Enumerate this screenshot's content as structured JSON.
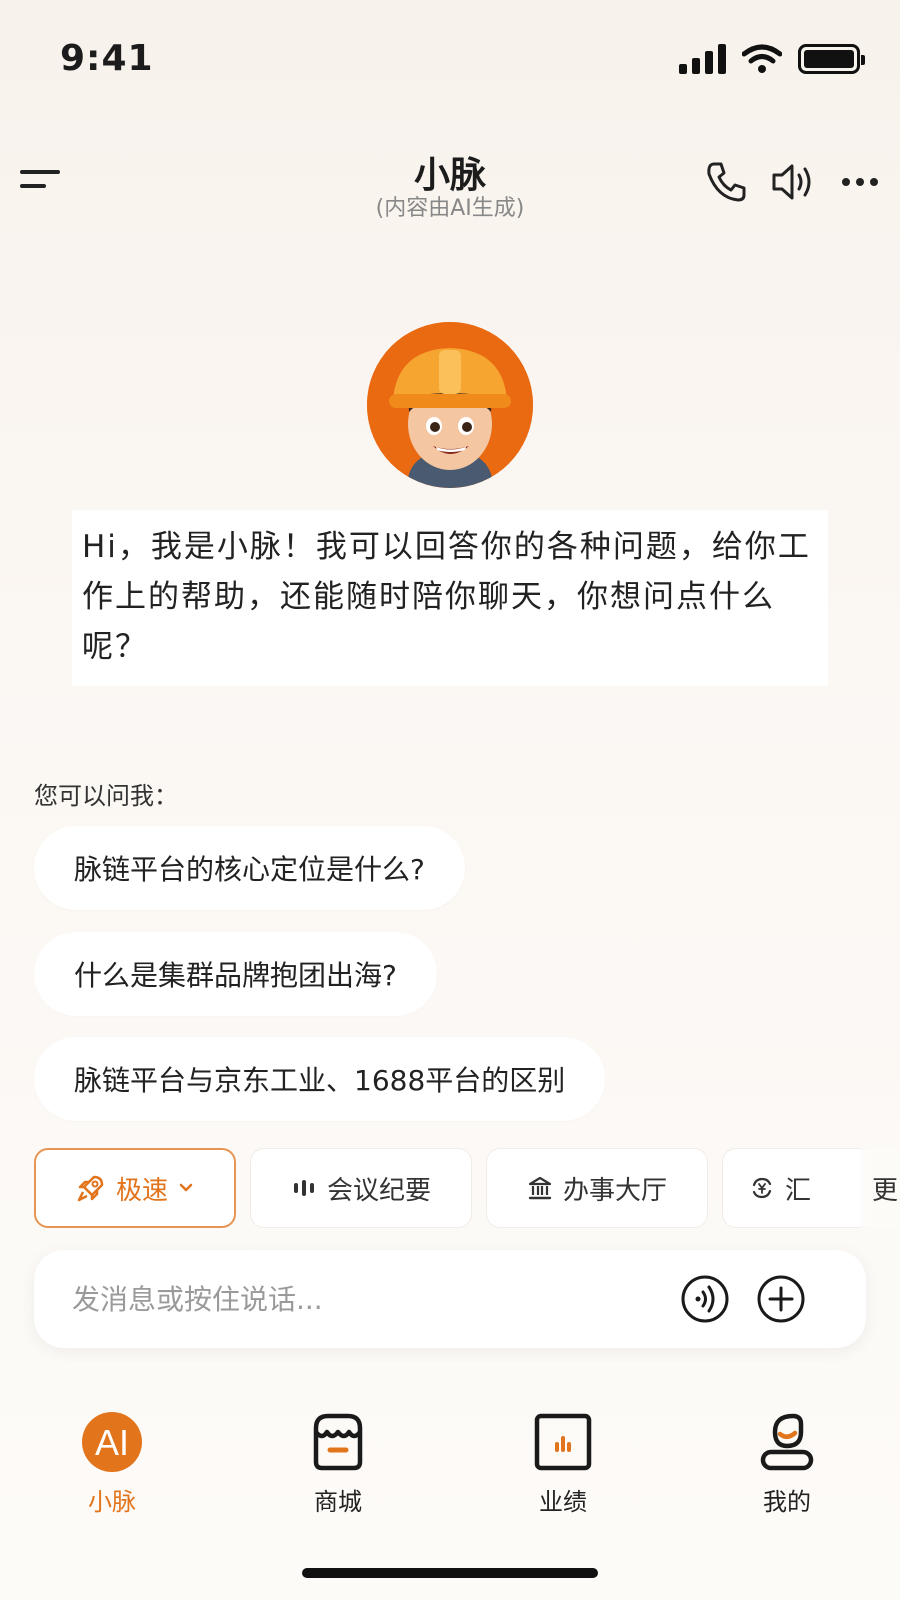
{
  "status_bar": {
    "time": "9:41"
  },
  "header": {
    "title": "小脉",
    "subtitle": "(内容由AI生成)",
    "icons": [
      "menu-icon",
      "phone-icon",
      "speaker-icon",
      "more-icon"
    ]
  },
  "assistant": {
    "greeting": "Hi，我是小脉！我可以回答你的各种问题，给你工作上的帮助，还能随时陪你聊天，你想问点什么呢？"
  },
  "suggestions": {
    "label": "您可以问我：",
    "items": [
      "脉链平台的核心定位是什么?",
      "什么是集群品牌抱团出海?",
      "脉链平台与京东工业、1688平台的区别"
    ]
  },
  "chips": {
    "items": [
      {
        "label": "极速",
        "icon": "rocket-icon"
      },
      {
        "label": "会议纪要",
        "icon": "audio-wave-icon"
      },
      {
        "label": "办事大厅",
        "icon": "bank-icon"
      },
      {
        "label": "汇",
        "icon": "exchange-icon"
      }
    ],
    "more": "更多"
  },
  "input": {
    "placeholder": "发消息或按住说话..."
  },
  "tabbar": {
    "items": [
      {
        "label": "小脉",
        "icon_text": "AI"
      },
      {
        "label": "商城"
      },
      {
        "label": "业绩"
      },
      {
        "label": "我的"
      }
    ]
  },
  "colors": {
    "accent": "#e2741c",
    "avatar_bg": "#ea6a12",
    "background": "#f8f2ec"
  }
}
